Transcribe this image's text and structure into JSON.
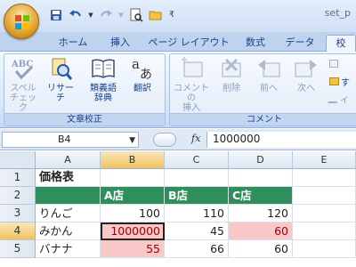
{
  "app": {
    "doc_title": "set_p"
  },
  "tabs": [
    {
      "label": "ホーム",
      "active": false
    },
    {
      "label": "挿入",
      "active": false
    },
    {
      "label": "ページ レイアウト",
      "active": false
    },
    {
      "label": "数式",
      "active": false
    },
    {
      "label": "データ",
      "active": false
    },
    {
      "label": "校",
      "active": true
    }
  ],
  "ribbon": {
    "groups": [
      {
        "label": "文章校正",
        "buttons": [
          {
            "label": "スペル\nチェック",
            "icon": "spellcheck-icon",
            "disabled": true
          },
          {
            "label": "リサーチ",
            "icon": "research-icon",
            "disabled": false
          },
          {
            "label": "類義語\n辞典",
            "icon": "thesaurus-icon",
            "disabled": false
          },
          {
            "label": "翻訳",
            "icon": "translate-icon",
            "disabled": false
          }
        ]
      },
      {
        "label": "コメント",
        "buttons": [
          {
            "label": "コメントの\n挿入",
            "icon": "new-comment-icon",
            "disabled": true
          },
          {
            "label": "削除",
            "icon": "delete-comment-icon",
            "disabled": true
          },
          {
            "label": "前へ",
            "icon": "previous-comment-icon",
            "disabled": true
          },
          {
            "label": "次へ",
            "icon": "next-comment-icon",
            "disabled": true
          }
        ],
        "small_buttons": [
          {
            "label": "",
            "icon": "show-hide-comment-icon"
          },
          {
            "label": "す",
            "icon": "show-all-comments-icon"
          },
          {
            "label": "イ",
            "icon": "show-ink-icon"
          }
        ]
      }
    ]
  },
  "formula_bar": {
    "name_box": "B4",
    "fx_label": "fx",
    "formula": "1000000"
  },
  "sheet": {
    "columns": [
      "A",
      "B",
      "C",
      "D",
      "E"
    ],
    "selected_column": "B",
    "rows": [
      "1",
      "2",
      "3",
      "4",
      "5"
    ],
    "selected_row": "4",
    "cells": {
      "A1": "価格表",
      "A2": "",
      "B2": "A店",
      "C2": "B店",
      "D2": "C店",
      "A3": "りんご",
      "B3": "100",
      "C3": "110",
      "D3": "120",
      "A4": "みかん",
      "B4": "1000000",
      "C4": "45",
      "D4": "60",
      "A5": "バナナ",
      "B5": "55",
      "C5": "66",
      "D5": "60"
    },
    "highlight_color_green": "#2f8f5c",
    "highlight_color_red": "#f8c7c7"
  }
}
